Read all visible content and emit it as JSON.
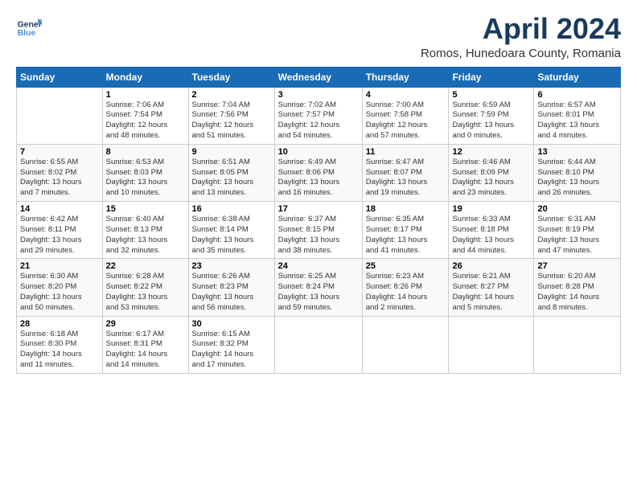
{
  "header": {
    "logo": "GeneralBlue",
    "month_year": "April 2024",
    "location": "Romos, Hunedoara County, Romania"
  },
  "days_of_week": [
    "Sunday",
    "Monday",
    "Tuesday",
    "Wednesday",
    "Thursday",
    "Friday",
    "Saturday"
  ],
  "weeks": [
    [
      {
        "day": "",
        "info": ""
      },
      {
        "day": "1",
        "info": "Sunrise: 7:06 AM\nSunset: 7:54 PM\nDaylight: 12 hours\nand 48 minutes."
      },
      {
        "day": "2",
        "info": "Sunrise: 7:04 AM\nSunset: 7:56 PM\nDaylight: 12 hours\nand 51 minutes."
      },
      {
        "day": "3",
        "info": "Sunrise: 7:02 AM\nSunset: 7:57 PM\nDaylight: 12 hours\nand 54 minutes."
      },
      {
        "day": "4",
        "info": "Sunrise: 7:00 AM\nSunset: 7:58 PM\nDaylight: 12 hours\nand 57 minutes."
      },
      {
        "day": "5",
        "info": "Sunrise: 6:59 AM\nSunset: 7:59 PM\nDaylight: 13 hours\nand 0 minutes."
      },
      {
        "day": "6",
        "info": "Sunrise: 6:57 AM\nSunset: 8:01 PM\nDaylight: 13 hours\nand 4 minutes."
      }
    ],
    [
      {
        "day": "7",
        "info": "Sunrise: 6:55 AM\nSunset: 8:02 PM\nDaylight: 13 hours\nand 7 minutes."
      },
      {
        "day": "8",
        "info": "Sunrise: 6:53 AM\nSunset: 8:03 PM\nDaylight: 13 hours\nand 10 minutes."
      },
      {
        "day": "9",
        "info": "Sunrise: 6:51 AM\nSunset: 8:05 PM\nDaylight: 13 hours\nand 13 minutes."
      },
      {
        "day": "10",
        "info": "Sunrise: 6:49 AM\nSunset: 8:06 PM\nDaylight: 13 hours\nand 16 minutes."
      },
      {
        "day": "11",
        "info": "Sunrise: 6:47 AM\nSunset: 8:07 PM\nDaylight: 13 hours\nand 19 minutes."
      },
      {
        "day": "12",
        "info": "Sunrise: 6:46 AM\nSunset: 8:09 PM\nDaylight: 13 hours\nand 23 minutes."
      },
      {
        "day": "13",
        "info": "Sunrise: 6:44 AM\nSunset: 8:10 PM\nDaylight: 13 hours\nand 26 minutes."
      }
    ],
    [
      {
        "day": "14",
        "info": "Sunrise: 6:42 AM\nSunset: 8:11 PM\nDaylight: 13 hours\nand 29 minutes."
      },
      {
        "day": "15",
        "info": "Sunrise: 6:40 AM\nSunset: 8:13 PM\nDaylight: 13 hours\nand 32 minutes."
      },
      {
        "day": "16",
        "info": "Sunrise: 6:38 AM\nSunset: 8:14 PM\nDaylight: 13 hours\nand 35 minutes."
      },
      {
        "day": "17",
        "info": "Sunrise: 6:37 AM\nSunset: 8:15 PM\nDaylight: 13 hours\nand 38 minutes."
      },
      {
        "day": "18",
        "info": "Sunrise: 6:35 AM\nSunset: 8:17 PM\nDaylight: 13 hours\nand 41 minutes."
      },
      {
        "day": "19",
        "info": "Sunrise: 6:33 AM\nSunset: 8:18 PM\nDaylight: 13 hours\nand 44 minutes."
      },
      {
        "day": "20",
        "info": "Sunrise: 6:31 AM\nSunset: 8:19 PM\nDaylight: 13 hours\nand 47 minutes."
      }
    ],
    [
      {
        "day": "21",
        "info": "Sunrise: 6:30 AM\nSunset: 8:20 PM\nDaylight: 13 hours\nand 50 minutes."
      },
      {
        "day": "22",
        "info": "Sunrise: 6:28 AM\nSunset: 8:22 PM\nDaylight: 13 hours\nand 53 minutes."
      },
      {
        "day": "23",
        "info": "Sunrise: 6:26 AM\nSunset: 8:23 PM\nDaylight: 13 hours\nand 56 minutes."
      },
      {
        "day": "24",
        "info": "Sunrise: 6:25 AM\nSunset: 8:24 PM\nDaylight: 13 hours\nand 59 minutes."
      },
      {
        "day": "25",
        "info": "Sunrise: 6:23 AM\nSunset: 8:26 PM\nDaylight: 14 hours\nand 2 minutes."
      },
      {
        "day": "26",
        "info": "Sunrise: 6:21 AM\nSunset: 8:27 PM\nDaylight: 14 hours\nand 5 minutes."
      },
      {
        "day": "27",
        "info": "Sunrise: 6:20 AM\nSunset: 8:28 PM\nDaylight: 14 hours\nand 8 minutes."
      }
    ],
    [
      {
        "day": "28",
        "info": "Sunrise: 6:18 AM\nSunset: 8:30 PM\nDaylight: 14 hours\nand 11 minutes."
      },
      {
        "day": "29",
        "info": "Sunrise: 6:17 AM\nSunset: 8:31 PM\nDaylight: 14 hours\nand 14 minutes."
      },
      {
        "day": "30",
        "info": "Sunrise: 6:15 AM\nSunset: 8:32 PM\nDaylight: 14 hours\nand 17 minutes."
      },
      {
        "day": "",
        "info": ""
      },
      {
        "day": "",
        "info": ""
      },
      {
        "day": "",
        "info": ""
      },
      {
        "day": "",
        "info": ""
      }
    ]
  ]
}
